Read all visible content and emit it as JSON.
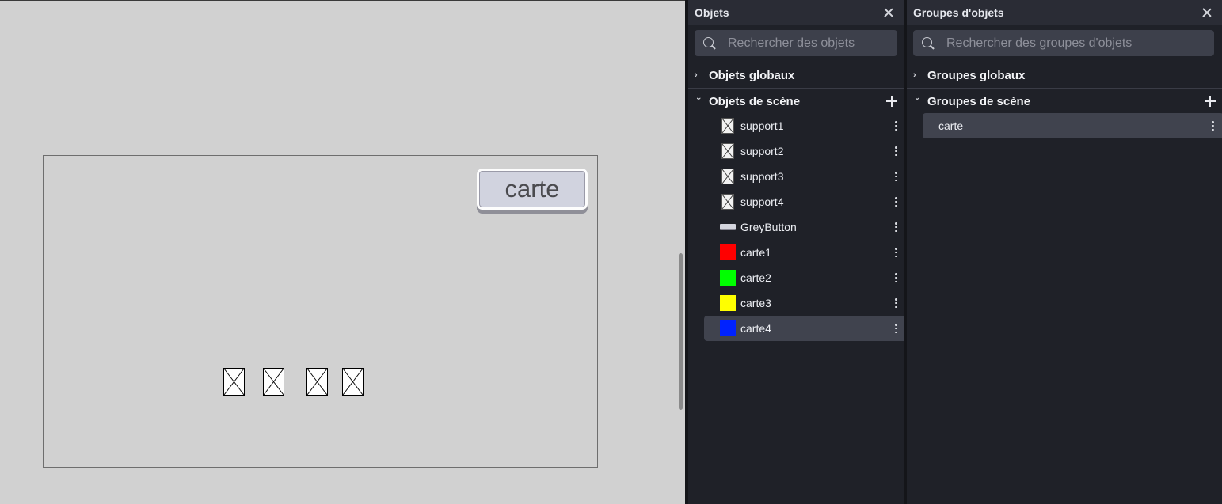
{
  "scene": {
    "carte_button_label": "carte",
    "supports": [
      "support1",
      "support2",
      "support3",
      "support4"
    ]
  },
  "objects_panel": {
    "title": "Objets",
    "search_placeholder": "Rechercher des objets",
    "global_section": "Objets globaux",
    "scene_section": "Objets de scène",
    "items": [
      {
        "name": "support1",
        "thumb": "support"
      },
      {
        "name": "support2",
        "thumb": "support"
      },
      {
        "name": "support3",
        "thumb": "support"
      },
      {
        "name": "support4",
        "thumb": "support"
      },
      {
        "name": "GreyButton",
        "thumb": "grey-button"
      },
      {
        "name": "carte1",
        "thumb": "color",
        "color": "#ff0000"
      },
      {
        "name": "carte2",
        "thumb": "color",
        "color": "#00ff00"
      },
      {
        "name": "carte3",
        "thumb": "color",
        "color": "#ffff00"
      },
      {
        "name": "carte4",
        "thumb": "color",
        "color": "#0022ff",
        "selected": true
      }
    ]
  },
  "groups_panel": {
    "title": "Groupes d'objets",
    "search_placeholder": "Rechercher des groupes d'objets",
    "global_section": "Groupes globaux",
    "scene_section": "Groupes de scène",
    "items": [
      {
        "name": "carte",
        "selected": true
      }
    ]
  },
  "icons": {
    "close": "close-icon",
    "search": "search-icon",
    "add": "plus-icon",
    "more": "kebab-icon",
    "collapsed": "chevron-right-icon",
    "expanded": "chevron-down-icon"
  }
}
